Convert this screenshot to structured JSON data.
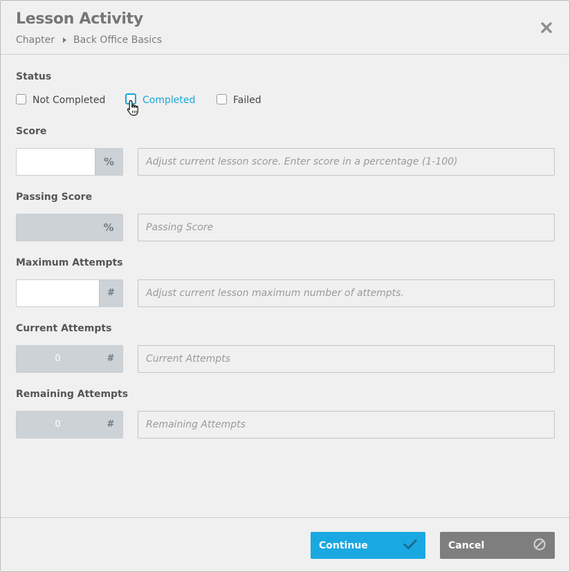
{
  "dialog": {
    "title": "Lesson Activity",
    "breadcrumb": [
      "Chapter",
      "Back Office Basics"
    ]
  },
  "status": {
    "label": "Status",
    "options": [
      {
        "label": "Not Completed",
        "checked": false
      },
      {
        "label": "Completed",
        "checked": false,
        "hovered": true
      },
      {
        "label": "Failed",
        "checked": false
      }
    ]
  },
  "fields": {
    "score": {
      "label": "Score",
      "value": "",
      "unit": "%",
      "placeholder": "Adjust current lesson score. Enter score in a percentage (1-100)"
    },
    "passing_score": {
      "label": "Passing Score",
      "value": "",
      "unit": "%",
      "placeholder": "Passing Score"
    },
    "maximum_attempts": {
      "label": "Maximum Attempts",
      "value": "",
      "unit": "#",
      "placeholder": "Adjust current lesson maximum number of attempts."
    },
    "current_attempts": {
      "label": "Current Attempts",
      "value": "0",
      "unit": "#",
      "placeholder": "Current Attempts"
    },
    "remaining_attempts": {
      "label": "Remaining Attempts",
      "value": "0",
      "unit": "#",
      "placeholder": "Remaining Attempts"
    }
  },
  "footer": {
    "continue_label": "Continue",
    "cancel_label": "Cancel"
  },
  "colors": {
    "accent": "#1aa8e2",
    "cancel": "#7e7e7e"
  },
  "icons": {
    "close": "close-icon",
    "breadcrumb_separator": "caret-right-icon",
    "continue": "checkmark-icon",
    "cancel": "cancel-circle-icon",
    "cursor": "hand-pointer-icon"
  }
}
